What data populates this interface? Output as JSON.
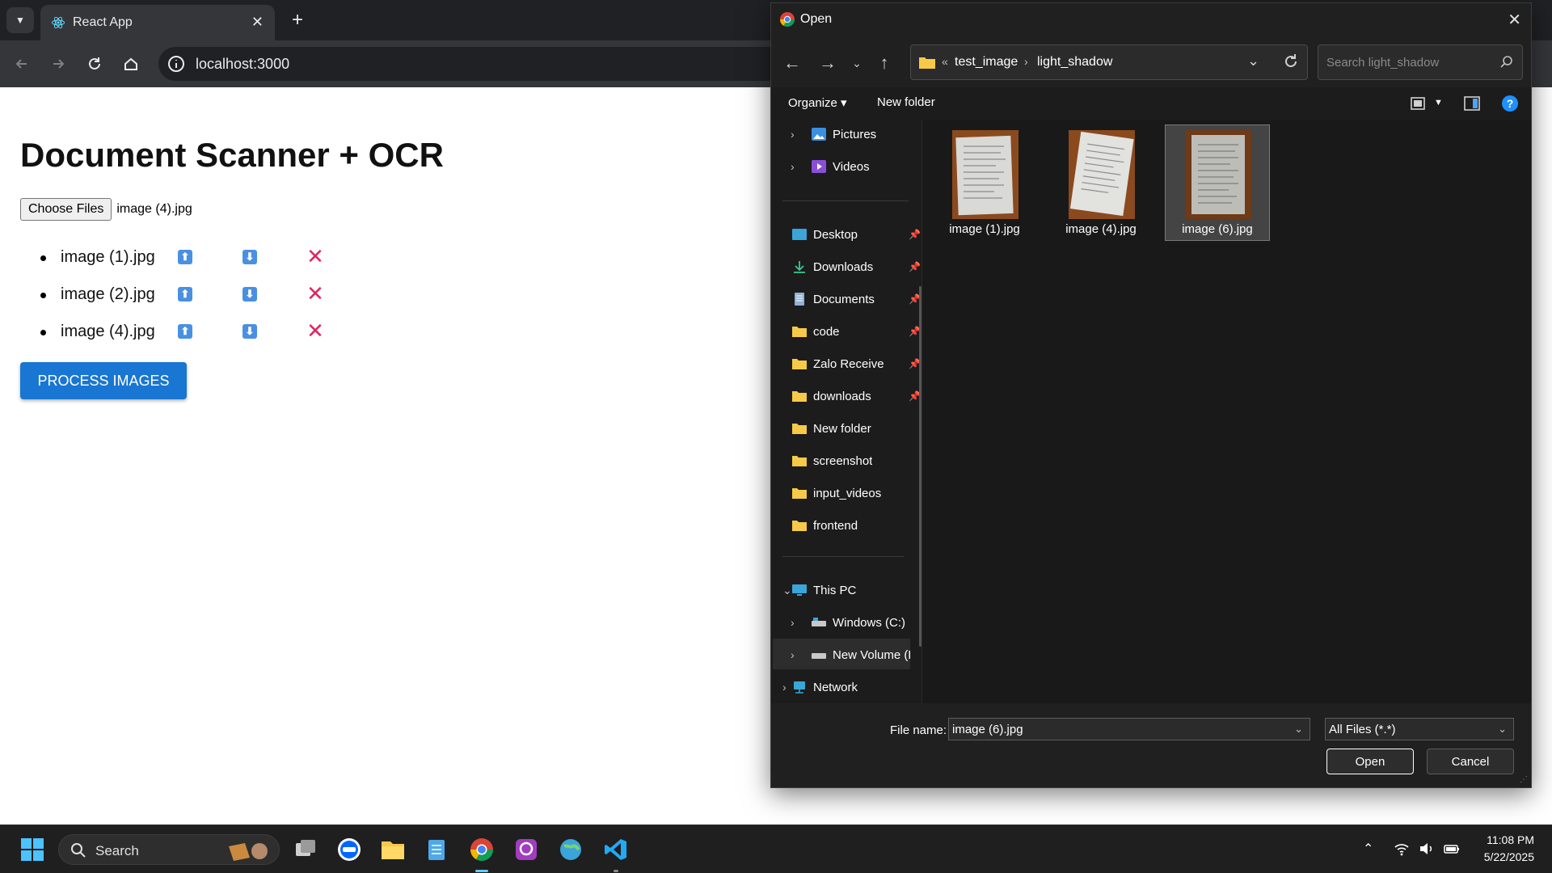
{
  "browser": {
    "tab_title": "React App",
    "url": "localhost:3000"
  },
  "page": {
    "title": "Document Scanner + OCR",
    "choose_files_label": "Choose Files",
    "chosen_file": "image (4).jpg",
    "files": [
      {
        "name": "image (1).jpg"
      },
      {
        "name": "image (2).jpg"
      },
      {
        "name": "image (4).jpg"
      }
    ],
    "move_up_symbol": "⬆",
    "move_down_symbol": "⬇",
    "delete_symbol": "✕",
    "process_button": "PROCESS IMAGES"
  },
  "dialog": {
    "title": "Open",
    "breadcrumb_overflow": "«",
    "breadcrumb": [
      "test_image",
      "light_shadow"
    ],
    "search_placeholder": "Search light_shadow",
    "organize_label": "Organize",
    "new_folder_label": "New folder",
    "nav_items": [
      {
        "label": "Pictures",
        "icon": "pictures-icon",
        "expandable": true
      },
      {
        "label": "Videos",
        "icon": "videos-icon",
        "expandable": true
      },
      {
        "label": "Desktop",
        "icon": "desktop-icon",
        "pinned": true
      },
      {
        "label": "Downloads",
        "icon": "download-icon",
        "pinned": true
      },
      {
        "label": "Documents",
        "icon": "documents-icon",
        "pinned": true
      },
      {
        "label": "code",
        "icon": "folder-icon",
        "pinned": true
      },
      {
        "label": "Zalo Receive",
        "icon": "folder-icon",
        "pinned": true
      },
      {
        "label": "downloads",
        "icon": "folder-icon",
        "pinned": true
      },
      {
        "label": "New folder",
        "icon": "folder-icon"
      },
      {
        "label": "screenshot",
        "icon": "folder-icon"
      },
      {
        "label": "input_videos",
        "icon": "folder-icon"
      },
      {
        "label": "frontend",
        "icon": "folder-icon"
      },
      {
        "label": "This PC",
        "icon": "pc-icon",
        "expanded": true
      },
      {
        "label": "Windows (C:)",
        "icon": "drive-icon",
        "expandable": true
      },
      {
        "label": "New Volume (D:)",
        "icon": "drive-icon",
        "expandable": true,
        "selected": true
      },
      {
        "label": "Network",
        "icon": "network-icon",
        "expandable": true
      }
    ],
    "files": [
      {
        "name": "image (1).jpg",
        "selected": false
      },
      {
        "name": "image (4).jpg",
        "selected": false
      },
      {
        "name": "image (6).jpg",
        "selected": true
      }
    ],
    "file_name_label": "File name:",
    "file_name_value": "image (6).jpg",
    "file_type": "All Files (*.*)",
    "open_label": "Open",
    "cancel_label": "Cancel"
  },
  "taskbar": {
    "search_label": "Search",
    "time": "11:08 PM",
    "date": "5/22/2025"
  },
  "colors": {
    "process_button": "#1976d2",
    "delete_icon": "#e0245e",
    "arrow_button": "#4a90e2",
    "folder": "#f7c948"
  }
}
